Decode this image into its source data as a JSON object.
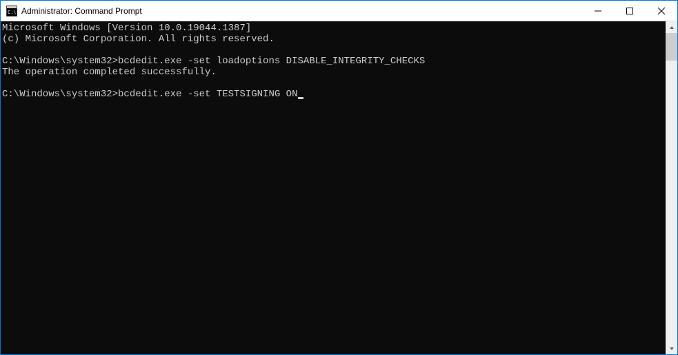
{
  "window": {
    "title": "Administrator: Command Prompt"
  },
  "terminal": {
    "lines": [
      "Microsoft Windows [Version 10.0.19044.1387]",
      "(c) Microsoft Corporation. All rights reserved.",
      "",
      "C:\\Windows\\system32>bcdedit.exe -set loadoptions DISABLE_INTEGRITY_CHECKS",
      "The operation completed successfully.",
      "",
      "C:\\Windows\\system32>bcdedit.exe -set TESTSIGNING ON"
    ]
  },
  "colors": {
    "window_border": "#0078d7",
    "terminal_bg": "#0c0c0c",
    "terminal_fg": "#cccccc"
  }
}
